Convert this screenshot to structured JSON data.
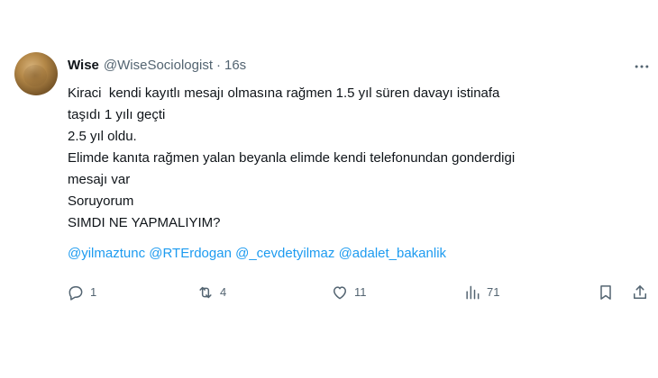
{
  "tweet": {
    "display_name": "Wise",
    "handle": "@WiseSociologist",
    "separator": "·",
    "timestamp": "16s",
    "lines": [
      "Kiraci  kendi kayıtlı mesajı olmasına rağmen 1.5 yıl süren davayı istinafa",
      "taşıdı 1 yılı geçti",
      "2.5 yıl oldu.",
      "Elimde kanıta rağmen yalan beyanla elimde kendi telefonundan gonderdigi",
      "mesajı var",
      "Soruyorum",
      "SIMDI NE YAPMALIYIM?"
    ],
    "mentions": [
      "@yilmaztunc",
      "@RTErdogan",
      "@_cevdetyilmaz",
      "@adalet_bakanlik"
    ]
  },
  "actions": {
    "reply_count": "1",
    "retweet_count": "4",
    "like_count": "11",
    "views_count": "71"
  },
  "icons": {
    "more": "more-horizontal-icon",
    "reply": "reply-icon",
    "retweet": "retweet-icon",
    "like": "heart-icon",
    "views": "views-chart-icon",
    "bookmark": "bookmark-icon",
    "share": "share-icon"
  },
  "colors": {
    "text": "#0f1419",
    "secondary": "#536471",
    "link": "#1d9bf0"
  }
}
